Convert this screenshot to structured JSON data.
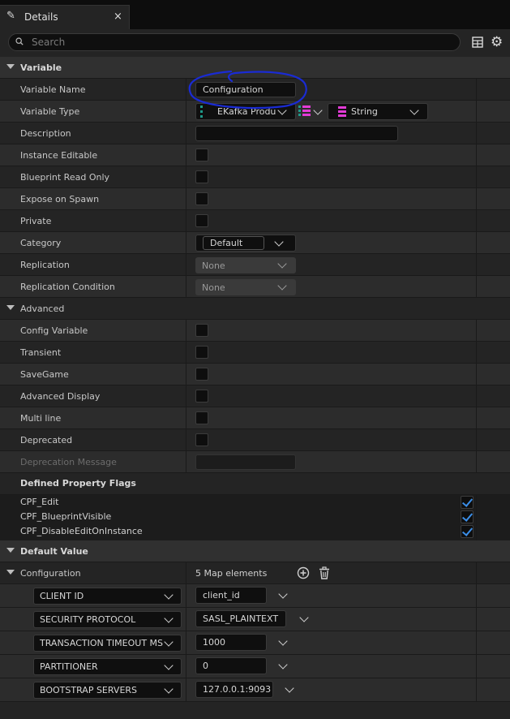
{
  "tab": {
    "title": "Details",
    "close": "×"
  },
  "search": {
    "placeholder": "Search"
  },
  "variable_section": {
    "title": "Variable",
    "variable_name": {
      "label": "Variable Name",
      "value": "Configuration"
    },
    "variable_type": {
      "label": "Variable Type",
      "key_type": "EKafka Produ",
      "value_type": "String"
    },
    "description": {
      "label": "Description",
      "value": ""
    },
    "instance_editable": {
      "label": "Instance Editable",
      "checked": false
    },
    "blueprint_read_only": {
      "label": "Blueprint Read Only",
      "checked": false
    },
    "expose_on_spawn": {
      "label": "Expose on Spawn",
      "checked": false
    },
    "private": {
      "label": "Private",
      "checked": false
    },
    "category": {
      "label": "Category",
      "value": "Default"
    },
    "replication": {
      "label": "Replication",
      "value": "None"
    },
    "replication_condition": {
      "label": "Replication Condition",
      "value": "None"
    }
  },
  "advanced_section": {
    "title": "Advanced",
    "config_variable": {
      "label": "Config Variable",
      "checked": false
    },
    "transient": {
      "label": "Transient",
      "checked": false
    },
    "savegame": {
      "label": "SaveGame",
      "checked": false
    },
    "advanced_display": {
      "label": "Advanced Display",
      "checked": false
    },
    "multi_line": {
      "label": "Multi line",
      "checked": false
    },
    "deprecated": {
      "label": "Deprecated",
      "checked": false
    },
    "deprecation_message": {
      "label": "Deprecation Message",
      "value": ""
    },
    "defined_property_flags": {
      "title": "Defined Property Flags",
      "flags": [
        {
          "name": "CPF_Edit",
          "checked": true
        },
        {
          "name": "CPF_BlueprintVisible",
          "checked": true
        },
        {
          "name": "CPF_DisableEditOnInstance",
          "checked": true
        }
      ]
    }
  },
  "default_value_section": {
    "title": "Default Value",
    "configuration": {
      "label": "Configuration",
      "count_text": "5 Map elements"
    },
    "map_entries": [
      {
        "key": "CLIENT ID",
        "value": "client_id"
      },
      {
        "key": "SECURITY PROTOCOL",
        "value": "SASL_PLAINTEXT"
      },
      {
        "key": "TRANSACTION TIMEOUT MS",
        "value": "1000"
      },
      {
        "key": "PARTITIONER",
        "value": "0"
      },
      {
        "key": "BOOTSTRAP SERVERS",
        "value": "127.0.0.1:9093"
      }
    ]
  },
  "colors": {
    "accent_blue": "#3b8ee8",
    "pin_magenta": "#e23bd6",
    "pin_teal": "#1f9a8a",
    "annotation_ink": "#1a2bd4"
  }
}
